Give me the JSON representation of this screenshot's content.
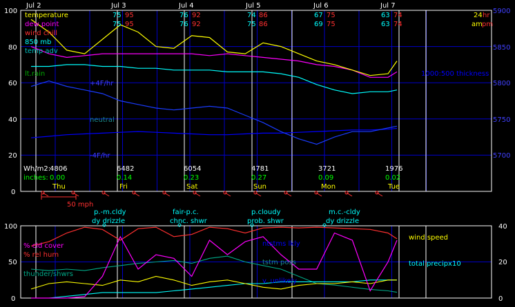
{
  "colors": {
    "temperature": "#ffff00",
    "dew_point": "#ff00ff",
    "wind_chill": "#ff3030",
    "mb850": "#00ffff",
    "temp_adv": "#00c0c0",
    "thickness": "#0000ff",
    "grid": "#0000cc",
    "day_line": "#ffffff",
    "axis": "#ffffff",
    "rain": "#00c000",
    "label_blue": "#4040ff",
    "cloud_cover": "#ff00ff",
    "rel_hum": "#ff3030",
    "wind_speed": "#ffff00",
    "thunder": "#00aa88",
    "precip": "#00ffff"
  },
  "top_dates": [
    "Jul 2",
    "Jul 3",
    "Jul 4",
    "Jul 5",
    "Jul 6",
    "Jul 7"
  ],
  "left_labels": {
    "temperature": "temperature",
    "dew_point": "dew point",
    "wind_chill": "wind chill",
    "mb850": "850 mb",
    "temp_adv": "temp adv",
    "lt_rain": "lt.rain",
    "plus4": "+4F/hr",
    "neutral": "neutral",
    "minus4": "-4F/hr"
  },
  "right_labels": {
    "hr24": "24",
    "hr_unit": "hr",
    "am": "am",
    "pm": "pm",
    "thickness": "1000:500 thickness"
  },
  "day_readouts": [
    {
      "t1": "75",
      "t2": "95",
      "d1": "75",
      "d2": "95"
    },
    {
      "t1": "76",
      "t2": "92",
      "d1": "76",
      "d2": "92"
    },
    {
      "t1": "74",
      "t2": "86",
      "d1": "75",
      "d2": "86"
    },
    {
      "t1": "67",
      "t2": "75",
      "d1": "69",
      "d2": "75"
    },
    {
      "t1": "63",
      "t2": "74",
      "d1": "63",
      "d2": "74"
    }
  ],
  "wh_label": "Wh/m2:",
  "wh_values": [
    "4806",
    "6482",
    "6054",
    "4781",
    "3721",
    "1976"
  ],
  "inches_label": "inches:",
  "inch_values": [
    "0.00",
    "0.14",
    "0.23",
    "0.27",
    "0.09",
    "0.02"
  ],
  "weekdays": [
    "Thu",
    "Fri",
    "Sat",
    "Sun",
    "Mon",
    "Tue"
  ],
  "wind_scale_label": "50 mph",
  "sky_labels": [
    {
      "l1": "p.-m.cldy",
      "l2": "dy drizzle"
    },
    {
      "l1": "fair-p.c.",
      "l2": "chnc. shwr"
    },
    {
      "l1": "p.cloudy",
      "l2": "prob. shwr"
    },
    {
      "l1": "m.c.-cldy",
      "l2": "dy drizzle"
    }
  ],
  "lower_labels": {
    "cld_cover": "% cld cover",
    "rel_hum": "% rel hum",
    "thunder": "thunder/shwrs",
    "wind_speed": "wind speed",
    "precip": "total precipx10",
    "tstm1": "ntstms lkly",
    "tstm2": "tstm poss",
    "tstm3": "v. unlikely"
  },
  "chart_data": [
    {
      "type": "line",
      "title": "",
      "x_tick_labels": [
        "Jul 2",
        "Jul 3",
        "Jul 4",
        "Jul 5",
        "Jul 6",
        "Jul 7"
      ],
      "y_left_ticks": [
        0,
        20,
        40,
        60,
        80,
        100
      ],
      "y_right_ticks": [
        5700,
        5750,
        5800,
        5850,
        5900
      ],
      "ylim": [
        0,
        100
      ],
      "y2lim": [
        5680,
        5910
      ],
      "x_hours": [
        0,
        6,
        12,
        18,
        24,
        30,
        36,
        42,
        48,
        54,
        60,
        66,
        72,
        78,
        84,
        90,
        96,
        102,
        108,
        114,
        120,
        123
      ],
      "series": [
        {
          "name": "temperature",
          "values": [
            95,
            88,
            78,
            76,
            84,
            92,
            88,
            80,
            79,
            86,
            85,
            77,
            76,
            82,
            80,
            76,
            72,
            70,
            67,
            64,
            65,
            72
          ]
        },
        {
          "name": "dew point",
          "values": [
            80,
            76,
            74,
            75,
            76,
            76,
            76,
            76,
            76,
            76,
            75,
            76,
            75,
            74,
            73,
            72,
            70,
            69,
            67,
            63,
            63,
            66
          ]
        },
        {
          "name": "850 mb",
          "values": [
            69,
            69,
            70,
            70,
            69,
            69,
            68,
            68,
            67,
            67,
            67,
            66,
            66,
            66,
            65,
            63,
            59,
            56,
            54,
            55,
            55,
            56
          ]
        },
        {
          "name": "temp adv",
          "values": [
            58,
            61,
            58,
            56,
            54,
            50,
            48,
            46,
            45,
            46,
            47,
            46,
            42,
            38,
            33,
            29,
            26,
            30,
            33,
            33,
            35,
            36
          ]
        },
        {
          "name": "1000:500 thickness",
          "values": [
            5748,
            5750,
            5752,
            5753,
            5754,
            5755,
            5756,
            5755,
            5754,
            5753,
            5752,
            5752,
            5753,
            5754,
            5754,
            5755,
            5756,
            5757,
            5758,
            5758,
            5759,
            5760
          ]
        }
      ]
    },
    {
      "type": "line",
      "title": "",
      "y_left_ticks": [
        0,
        50,
        100
      ],
      "y_right_ticks": [
        0,
        20,
        40
      ],
      "ylim": [
        0,
        100
      ],
      "y2lim": [
        0,
        40
      ],
      "x_hours": [
        0,
        6,
        12,
        18,
        24,
        30,
        36,
        42,
        48,
        54,
        60,
        66,
        72,
        78,
        84,
        90,
        96,
        102,
        108,
        114,
        120,
        123
      ],
      "series": [
        {
          "name": "% cld cover",
          "values": [
            0,
            0,
            0,
            2,
            30,
            85,
            40,
            60,
            55,
            30,
            80,
            60,
            78,
            85,
            60,
            40,
            40,
            90,
            80,
            10,
            50,
            80
          ]
        },
        {
          "name": "% rel hum",
          "values": [
            72,
            78,
            90,
            98,
            95,
            80,
            96,
            98,
            85,
            88,
            98,
            96,
            90,
            97,
            98,
            97,
            98,
            97,
            96,
            95,
            90,
            82
          ]
        },
        {
          "name": "thunder/shwrs",
          "values": [
            40,
            38,
            40,
            38,
            42,
            45,
            48,
            50,
            52,
            48,
            55,
            58,
            50,
            45,
            40,
            30,
            20,
            18,
            15,
            12,
            10,
            8
          ]
        },
        {
          "name": "wind speed",
          "values": [
            5,
            8,
            9,
            8,
            7,
            10,
            9,
            12,
            10,
            7,
            9,
            10,
            8,
            6,
            5,
            7,
            8,
            8,
            9,
            8,
            10,
            10
          ]
        },
        {
          "name": "total precipx10",
          "values": [
            0,
            0,
            1,
            2,
            3,
            3,
            3,
            3,
            4,
            5,
            6,
            7,
            8,
            8,
            9,
            9,
            9,
            9,
            9,
            10,
            10,
            10
          ]
        }
      ]
    }
  ]
}
